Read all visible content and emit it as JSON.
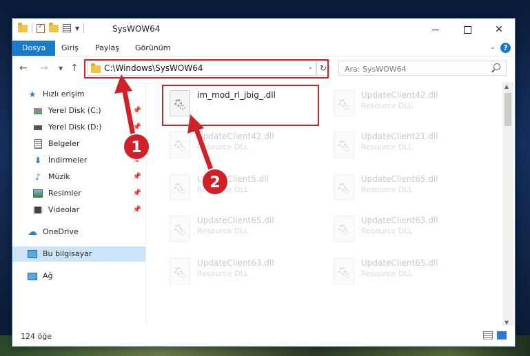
{
  "window": {
    "title": "SysWOW64"
  },
  "ribbon": {
    "tabs": [
      {
        "label": "Dosya",
        "active": true
      },
      {
        "label": "Giriş",
        "active": false
      },
      {
        "label": "Paylaş",
        "active": false
      },
      {
        "label": "Görünüm",
        "active": false
      }
    ],
    "help_label": "?"
  },
  "nav": {
    "address": "C:\\Windows\\SysWOW64",
    "search_placeholder": "Ara: SysWOW64"
  },
  "sidebar": {
    "items": [
      {
        "label": "Hızlı erişim",
        "icon": "star-icon",
        "pinned": false
      },
      {
        "label": "Yerel Disk (C:)",
        "icon": "drive-icon",
        "pinned": true
      },
      {
        "label": "Yerel Disk (D:)",
        "icon": "drive-icon",
        "pinned": true
      },
      {
        "label": "Belgeler",
        "icon": "document-icon",
        "pinned": true
      },
      {
        "label": "İndirmeler",
        "icon": "download-icon",
        "pinned": true
      },
      {
        "label": "Müzik",
        "icon": "music-icon",
        "pinned": true
      },
      {
        "label": "Resimler",
        "icon": "pictures-icon",
        "pinned": true
      },
      {
        "label": "Videolar",
        "icon": "videos-icon",
        "pinned": true
      },
      {
        "label": "OneDrive",
        "icon": "cloud-icon",
        "pinned": false
      },
      {
        "label": "Bu bilgisayar",
        "icon": "computer-icon",
        "pinned": false,
        "selected": true
      },
      {
        "label": "Ağ",
        "icon": "network-icon",
        "pinned": false
      }
    ]
  },
  "files": [
    {
      "name": "im_mod_rl_jbig_.dll",
      "type": "",
      "highlighted": true
    },
    {
      "name": "UpdateClient42.dll",
      "type": "Resource DLL"
    },
    {
      "name": "UpdateClient42.dll",
      "type": "Resource DLL"
    },
    {
      "name": "UpdateClient21.dll",
      "type": "Resource DLL"
    },
    {
      "name": "UpdateClient5.dll",
      "type": "Resource DLL"
    },
    {
      "name": "UpdateClient65.dll",
      "type": "Resource DLL"
    },
    {
      "name": "UpdateClient65.dll",
      "type": "Resource DLL"
    },
    {
      "name": "UpdateClient63.dll",
      "type": "Resource DLL"
    },
    {
      "name": "UpdateClient63.dll",
      "type": "Resource DLL"
    },
    {
      "name": "UpdateClient65.dll",
      "type": "Resource DLL"
    }
  ],
  "status": {
    "count": "124 öğe"
  },
  "annotations": {
    "badge1": "1",
    "badge2": "2",
    "color": "#d0202a"
  }
}
